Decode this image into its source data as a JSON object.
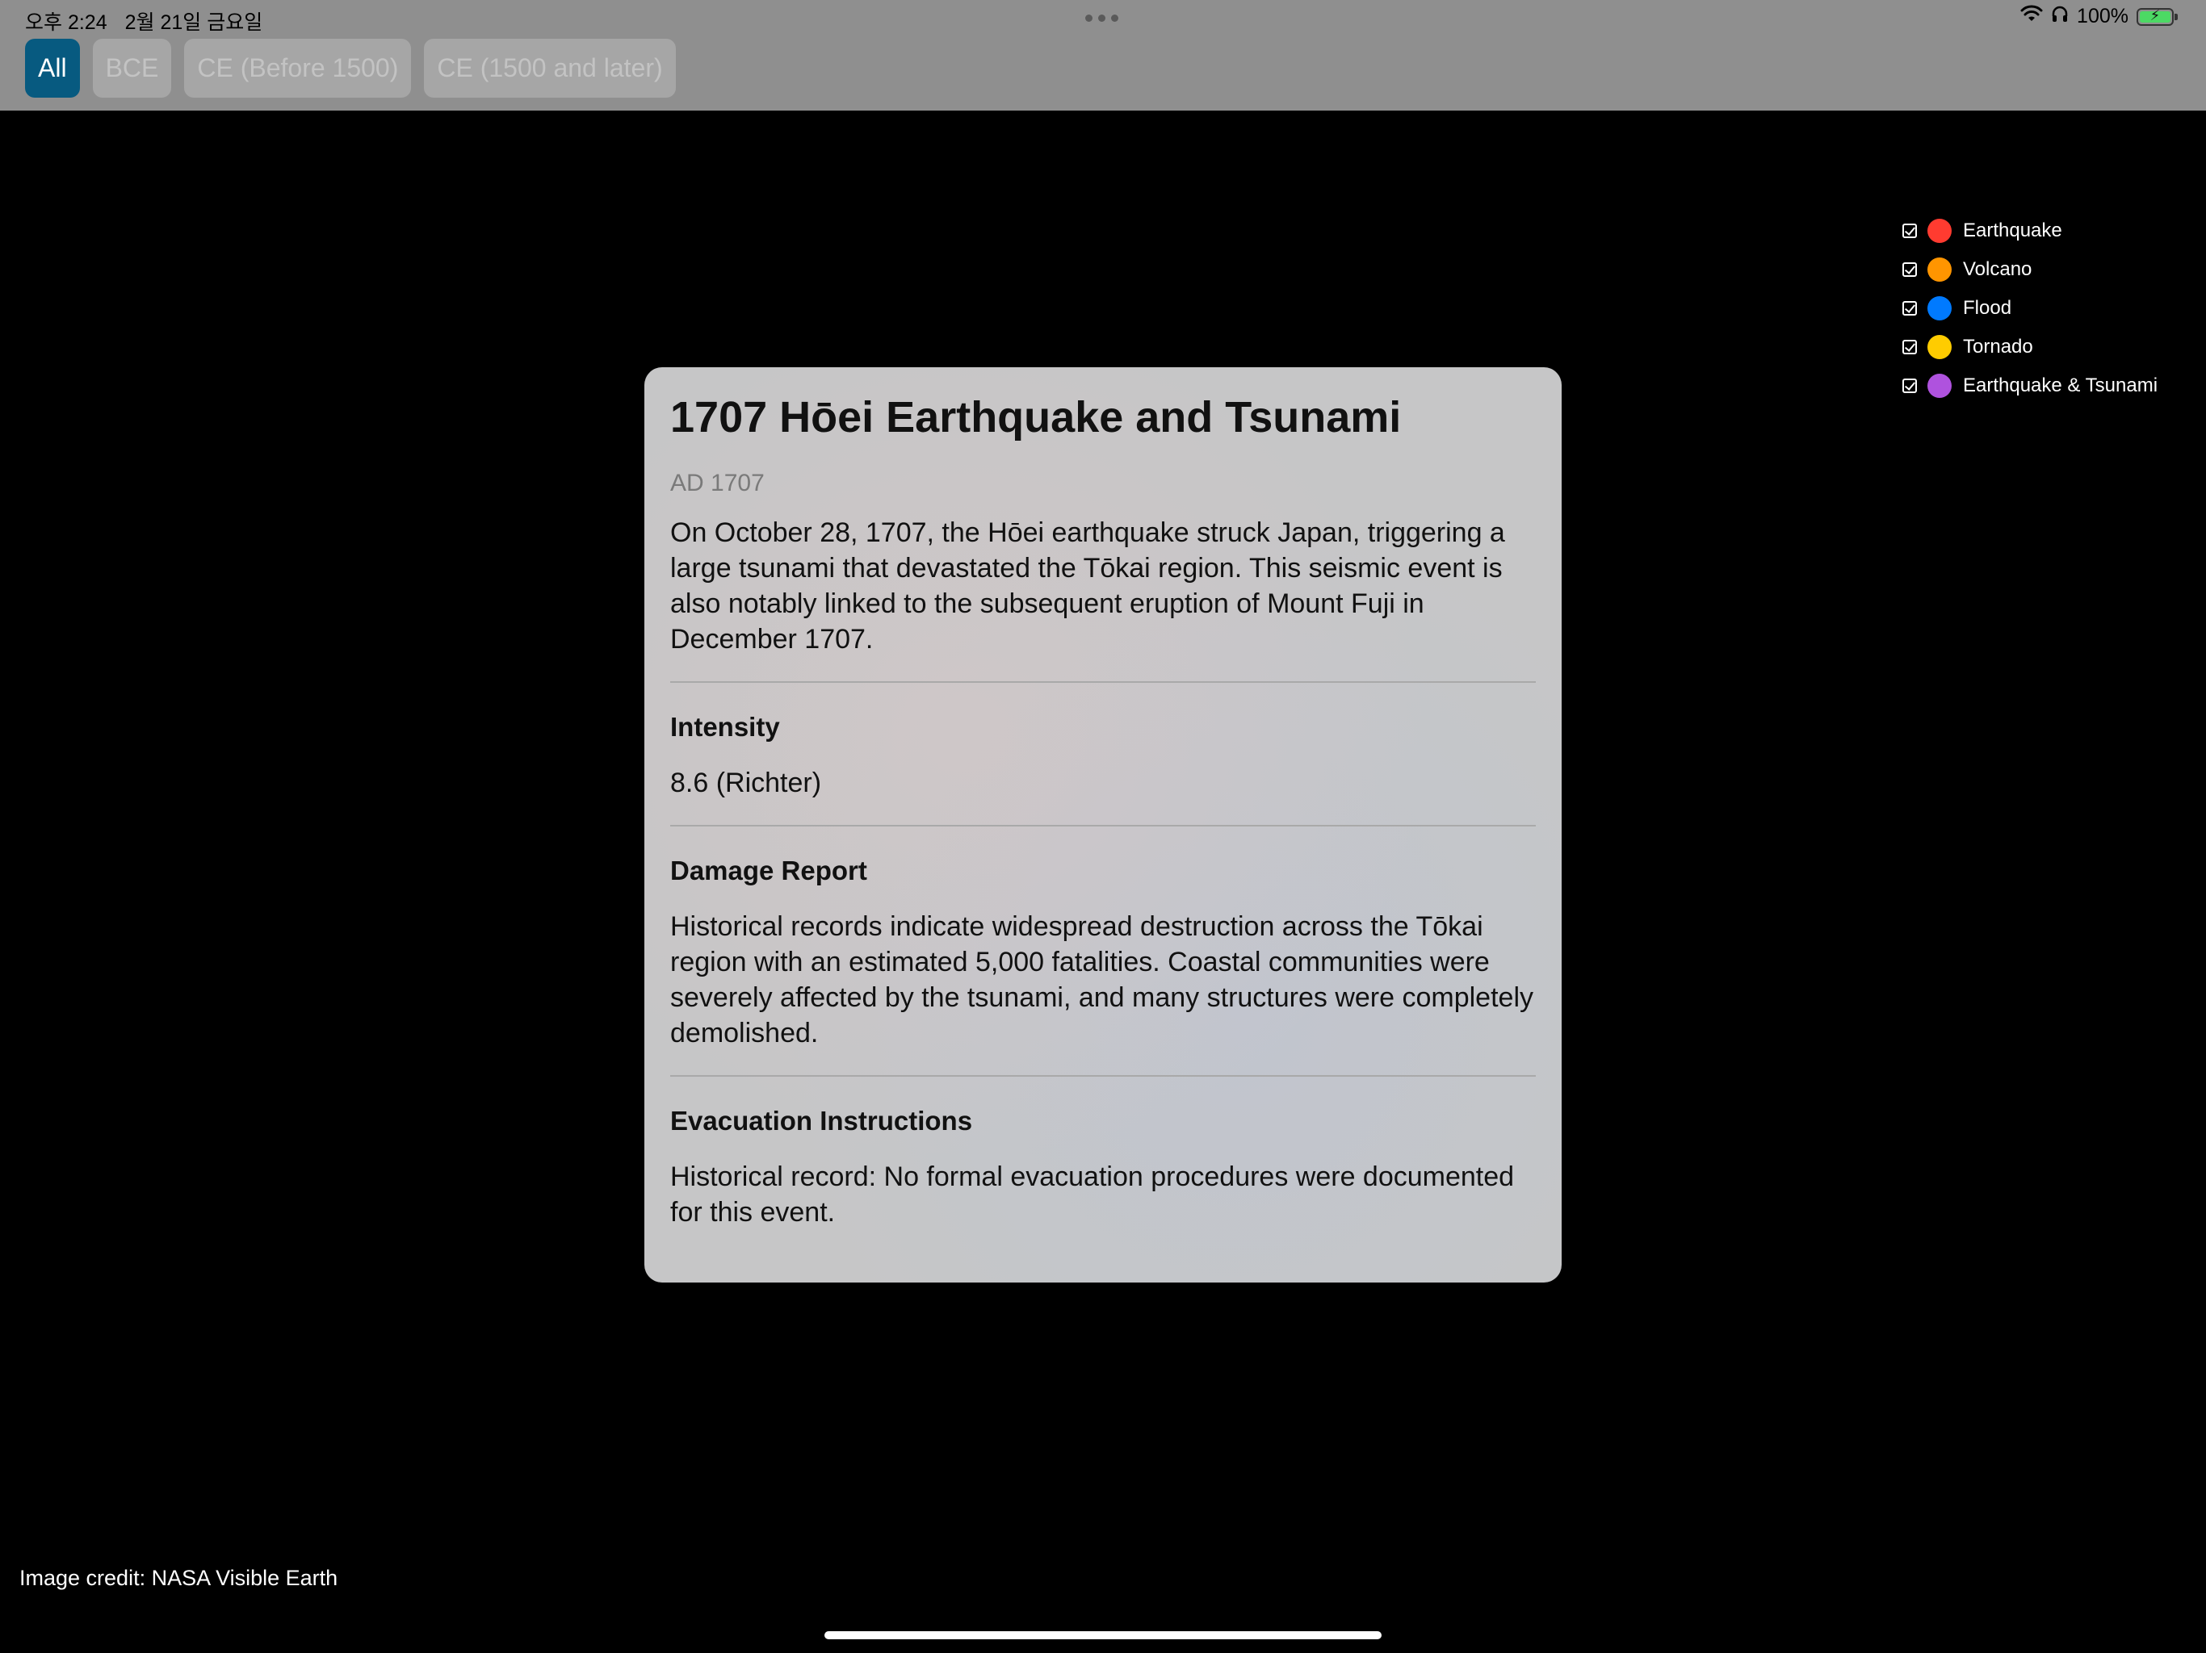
{
  "status": {
    "time": "오후 2:24",
    "date": "2월 21일 금요일",
    "battery": "100%",
    "battery_level": 1.0
  },
  "era_filters": [
    {
      "label": "All",
      "active": true
    },
    {
      "label": "BCE",
      "active": false
    },
    {
      "label": "CE (Before 1500)",
      "active": false
    },
    {
      "label": "CE (1500 and later)",
      "active": false
    }
  ],
  "legend": [
    {
      "label": "Earthquake",
      "color": "#ff3b30",
      "checked": true
    },
    {
      "label": "Volcano",
      "color": "#ff9500",
      "checked": true
    },
    {
      "label": "Flood",
      "color": "#007aff",
      "checked": true
    },
    {
      "label": "Tornado",
      "color": "#ffcc00",
      "checked": true
    },
    {
      "label": "Earthquake & Tsunami",
      "color": "#af52de",
      "checked": true
    }
  ],
  "event": {
    "title": "1707 Hōei Earthquake and Tsunami",
    "date": "AD 1707",
    "description": "On October 28, 1707, the Hōei earthquake struck Japan, triggering a large tsunami that devastated the Tōkai region. This seismic event is also notably linked to the subsequent eruption of Mount Fuji in December 1707.",
    "intensity_label": "Intensity",
    "intensity_value": "8.6 (Richter)",
    "damage_label": "Damage Report",
    "damage_text": "Historical records indicate widespread destruction across the Tōkai region with an estimated 5,000 fatalities. Coastal communities were severely affected by the tsunami, and many structures were completely demolished.",
    "evacuation_label": "Evacuation Instructions",
    "evacuation_text": "Historical record: No formal evacuation procedures were documented for this event."
  },
  "footer": {
    "credit": "Image credit: NASA Visible Earth"
  },
  "icons": {
    "wifi": "wifi-icon",
    "headphones": "headphones-icon",
    "battery": "battery-icon",
    "checkbox": "checkbox-checked-icon"
  }
}
